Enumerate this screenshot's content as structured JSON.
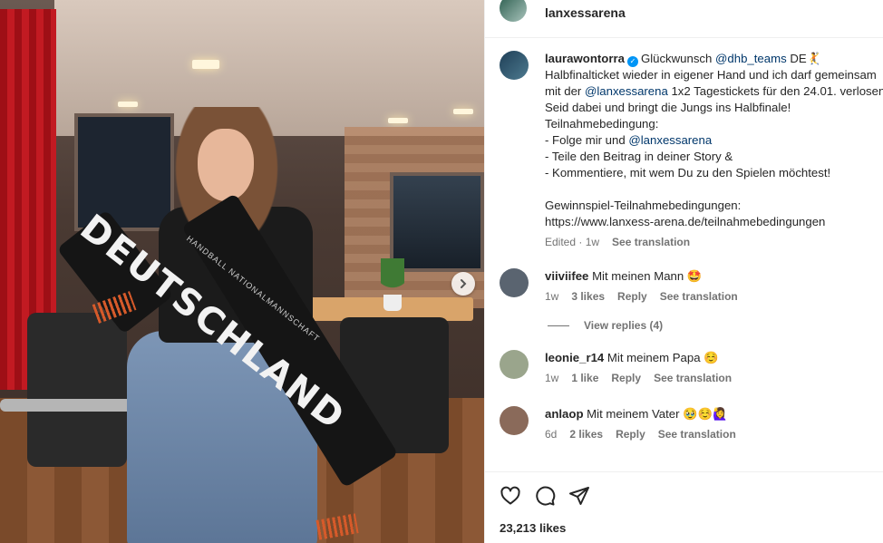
{
  "header": {
    "username": "lanxessarena"
  },
  "caption": {
    "username": "laurawontorra",
    "lines": [
      {
        "prefix": "Glückwunsch ",
        "mention": "@dhb_teams",
        "suffix": " DE🤾"
      },
      {
        "text": "Halbfinalticket wieder in eigener Hand und ich darf gemeinsam"
      },
      {
        "prefix": "mit der ",
        "mention": "@lanxessarena",
        "suffix": " 1x2 Tagestickets für den 24.01. verlosen"
      },
      {
        "text": "Seid dabei und bringt die Jungs ins Halbfinale!"
      },
      {
        "text": "Teilnahmebedingung:"
      },
      {
        "prefix": "- Folge mir und ",
        "mention": "@lanxessarena",
        "suffix": ""
      },
      {
        "text": "- Teile den Beitrag in deiner Story &"
      },
      {
        "text": "- Kommentiere, mit wem Du zu den Spielen möchtest!"
      },
      {
        "text": ""
      },
      {
        "text": "Gewinnspiel-Teilnahmebedingungen:"
      },
      {
        "text": "https://www.lanxess-arena.de/teilnahmebedingungen"
      }
    ],
    "meta_edited": "Edited · 1w",
    "see_translation": "See translation"
  },
  "comments": [
    {
      "username": "viiviifee",
      "text": "Mit meinen Mann 🤩",
      "age": "1w",
      "likes": "3 likes",
      "reply": "Reply",
      "see_translation": "See translation",
      "avatar_color": "#5a6470"
    },
    {
      "username": "leonie_r14",
      "text": "Mit meinem Papa ☺️",
      "age": "1w",
      "likes": "1 like",
      "reply": "Reply",
      "see_translation": "See translation",
      "avatar_color": "#9aa58c"
    },
    {
      "username": "anlaop",
      "text": "Mit meinem Vater 🥹☺️🙋‍♀️",
      "age": "6d",
      "likes": "2 likes",
      "reply": "Reply",
      "see_translation": "See translation",
      "avatar_color": "#8a6a5a"
    }
  ],
  "view_replies": "View replies (4)",
  "likes_count": "23,213 likes",
  "photo": {
    "scarf_text": "DEUTSCHLAND",
    "scarf_subtext": "HANDBALL NATIONALMANNSCHAFT"
  }
}
